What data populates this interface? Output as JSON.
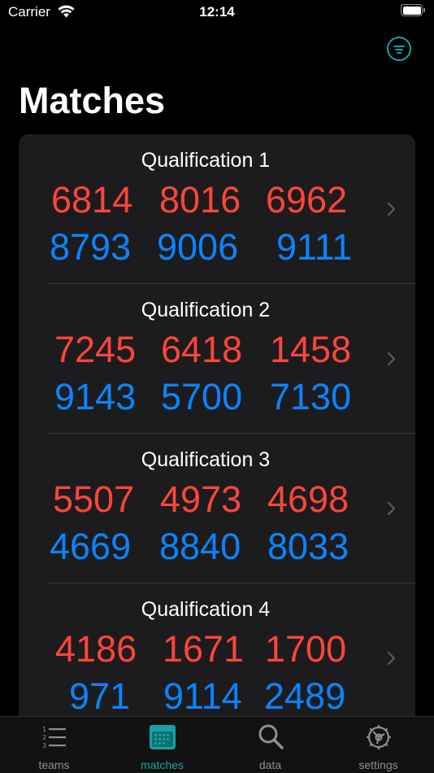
{
  "status_bar": {
    "carrier": "Carrier",
    "time": "12:14"
  },
  "header": {
    "title": "Matches",
    "filter_icon": "filter-circle-icon",
    "accent": "#16a2a6"
  },
  "colors": {
    "red_alliance": "#ff453a",
    "blue_alliance": "#0a84ff",
    "card": "#1c1c1e"
  },
  "matches": [
    {
      "name": "Qualification 1",
      "red": [
        "6814",
        "8016",
        "6962"
      ],
      "blue": [
        "8793",
        "9006",
        "9111"
      ]
    },
    {
      "name": "Qualification 2",
      "red": [
        "7245",
        "6418",
        "1458"
      ],
      "blue": [
        "9143",
        "5700",
        "7130"
      ]
    },
    {
      "name": "Qualification 3",
      "red": [
        "5507",
        "4973",
        "4698"
      ],
      "blue": [
        "4669",
        "8840",
        "8033"
      ]
    },
    {
      "name": "Qualification 4",
      "red": [
        "4186",
        "1671",
        "1700"
      ],
      "blue": [
        "971",
        "9114",
        "2489"
      ]
    }
  ],
  "tab_bar": {
    "items": [
      {
        "label": "teams",
        "icon": "numbered-list-icon"
      },
      {
        "label": "matches",
        "icon": "calendar-icon"
      },
      {
        "label": "data",
        "icon": "magnifying-glass-icon"
      },
      {
        "label": "settings",
        "icon": "gear-icon"
      }
    ],
    "active": "matches"
  }
}
